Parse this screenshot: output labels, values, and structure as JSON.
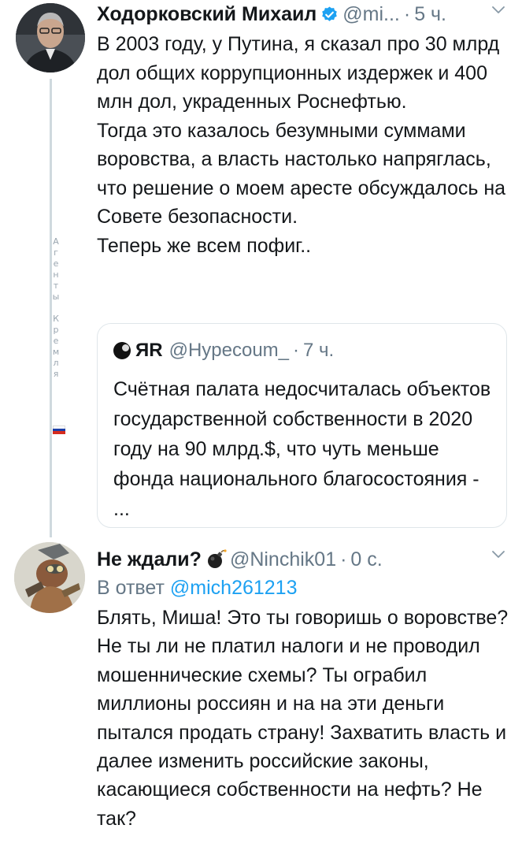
{
  "tweet1": {
    "author_name": "Ходорковский Михаил",
    "handle": "@mi...",
    "separator": "·",
    "time": "5 ч.",
    "text": "В 2003 году, у Путина, я сказал про 30 млрд дол общих коррупционных издержек и 400 млн дол, украденных Роснефтью.\nТогда это казалось безумными суммами воровства, а власть настолько напряглась, что решение о моем аресте обсуждалось на Совете безопасности.\nТеперь же всем пофиг..",
    "quoted": {
      "author_name": "ЯR",
      "handle": "@Hypecoum_",
      "separator": "·",
      "time": "7 ч.",
      "text": "Счётная палата недосчиталась объектов государственной собственности в 2020 году на 90 млрд.$, что чуть меньше фонда национального благосостояния - ..."
    }
  },
  "watermark": {
    "word1": [
      "А",
      "г",
      "е",
      "н",
      "т",
      "ы"
    ],
    "word2": [
      "К",
      "р",
      "е",
      "м",
      "л",
      "я"
    ],
    "flag_colors": [
      "#ffffff",
      "#1c3fa8",
      "#d52b1e"
    ]
  },
  "tweet2": {
    "author_name": "Не ждали?",
    "handle": "@Ninchik01",
    "separator": "·",
    "time": "0 с.",
    "reply_prefix": "В ответ",
    "reply_to": "@mich261213",
    "text": "Блять, Миша! Это ты говоришь о воровстве? Не ты ли не платил налоги и не проводил мошеннические схемы? Ты ограбил миллионы россиян и на на эти деньги пытался продать страну! Захватить власть и далее изменить российские законы, касающиеся собственности на нефть? Не так?"
  },
  "colors": {
    "link": "#1da1f2",
    "verified": "#1da1f2",
    "secondary_text": "#657786",
    "thread_line": "#cfd9de"
  }
}
